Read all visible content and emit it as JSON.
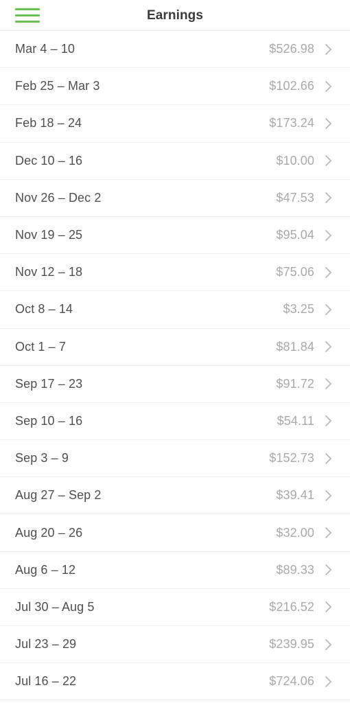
{
  "header": {
    "title": "Earnings",
    "menu_icon": "hamburger-menu-icon",
    "menu_color": "#6bbe56"
  },
  "colors": {
    "accent_green": "#6bbe56",
    "label_text": "#4f4f4f",
    "amount_text": "#a9a9a9",
    "divider": "#eeeff1",
    "background": "#ffffff"
  },
  "list": {
    "chevron_icon": "chevron-right-icon",
    "rows": [
      {
        "period": "Mar 4 – 10",
        "amount": "$526.98"
      },
      {
        "period": "Feb 25 – Mar 3",
        "amount": "$102.66"
      },
      {
        "period": "Feb 18 – 24",
        "amount": "$173.24"
      },
      {
        "period": "Dec 10 – 16",
        "amount": "$10.00"
      },
      {
        "period": "Nov 26 – Dec 2",
        "amount": "$47.53"
      },
      {
        "period": "Nov 19 – 25",
        "amount": "$95.04"
      },
      {
        "period": "Nov 12 – 18",
        "amount": "$75.06"
      },
      {
        "period": "Oct 8 – 14",
        "amount": "$3.25"
      },
      {
        "period": "Oct 1 – 7",
        "amount": "$81.84"
      },
      {
        "period": "Sep 17 – 23",
        "amount": "$91.72"
      },
      {
        "period": "Sep 10 – 16",
        "amount": "$54.11"
      },
      {
        "period": "Sep 3 – 9",
        "amount": "$152.73"
      },
      {
        "period": "Aug 27 – Sep 2",
        "amount": "$39.41"
      },
      {
        "period": "Aug 20 – 26",
        "amount": "$32.00"
      },
      {
        "period": "Aug 6 – 12",
        "amount": "$89.33"
      },
      {
        "period": "Jul 30 – Aug 5",
        "amount": "$216.52"
      },
      {
        "period": "Jul 23 – 29",
        "amount": "$239.95"
      },
      {
        "period": "Jul 16 – 22",
        "amount": "$724.06"
      }
    ]
  }
}
